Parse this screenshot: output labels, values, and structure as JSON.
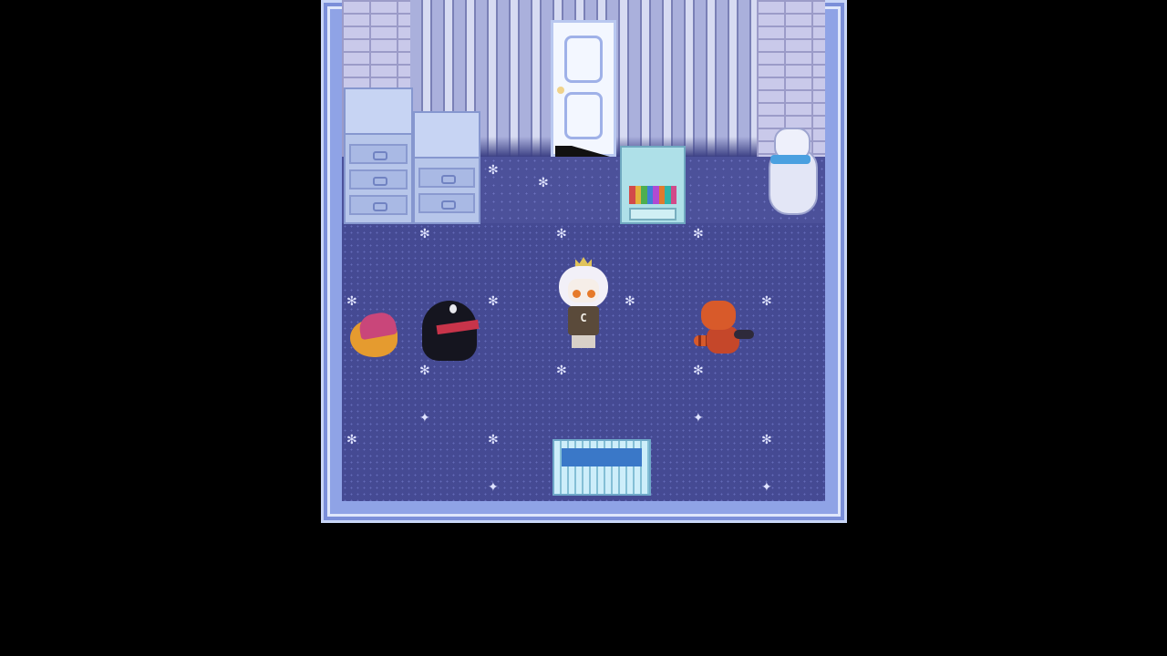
{
  "scene": {
    "type": "top-down pixel-art room",
    "area": "nursery bedroom",
    "colors": {
      "background": "#000000",
      "frame": "#8fa3e6",
      "carpet": "#4c519a",
      "wall_brick": "#c9c9ea",
      "wallpaper": "#8c93c4"
    }
  },
  "player": {
    "icon": "white-haired-child-with-crown",
    "shirt_letter": "C"
  },
  "npcs": [
    {
      "icon": "fox-plush-with-knit-hat"
    },
    {
      "icon": "black-crow-with-red-scarf"
    },
    {
      "icon": "red-panda-plush"
    },
    {
      "icon": "white-teddy-bear-with-blue-scarf"
    }
  ],
  "furniture": [
    {
      "icon": "tall-dresser"
    },
    {
      "icon": "short-dresser"
    },
    {
      "icon": "nightstand-with-books"
    },
    {
      "icon": "baby-crib"
    },
    {
      "icon": "white-door"
    }
  ]
}
